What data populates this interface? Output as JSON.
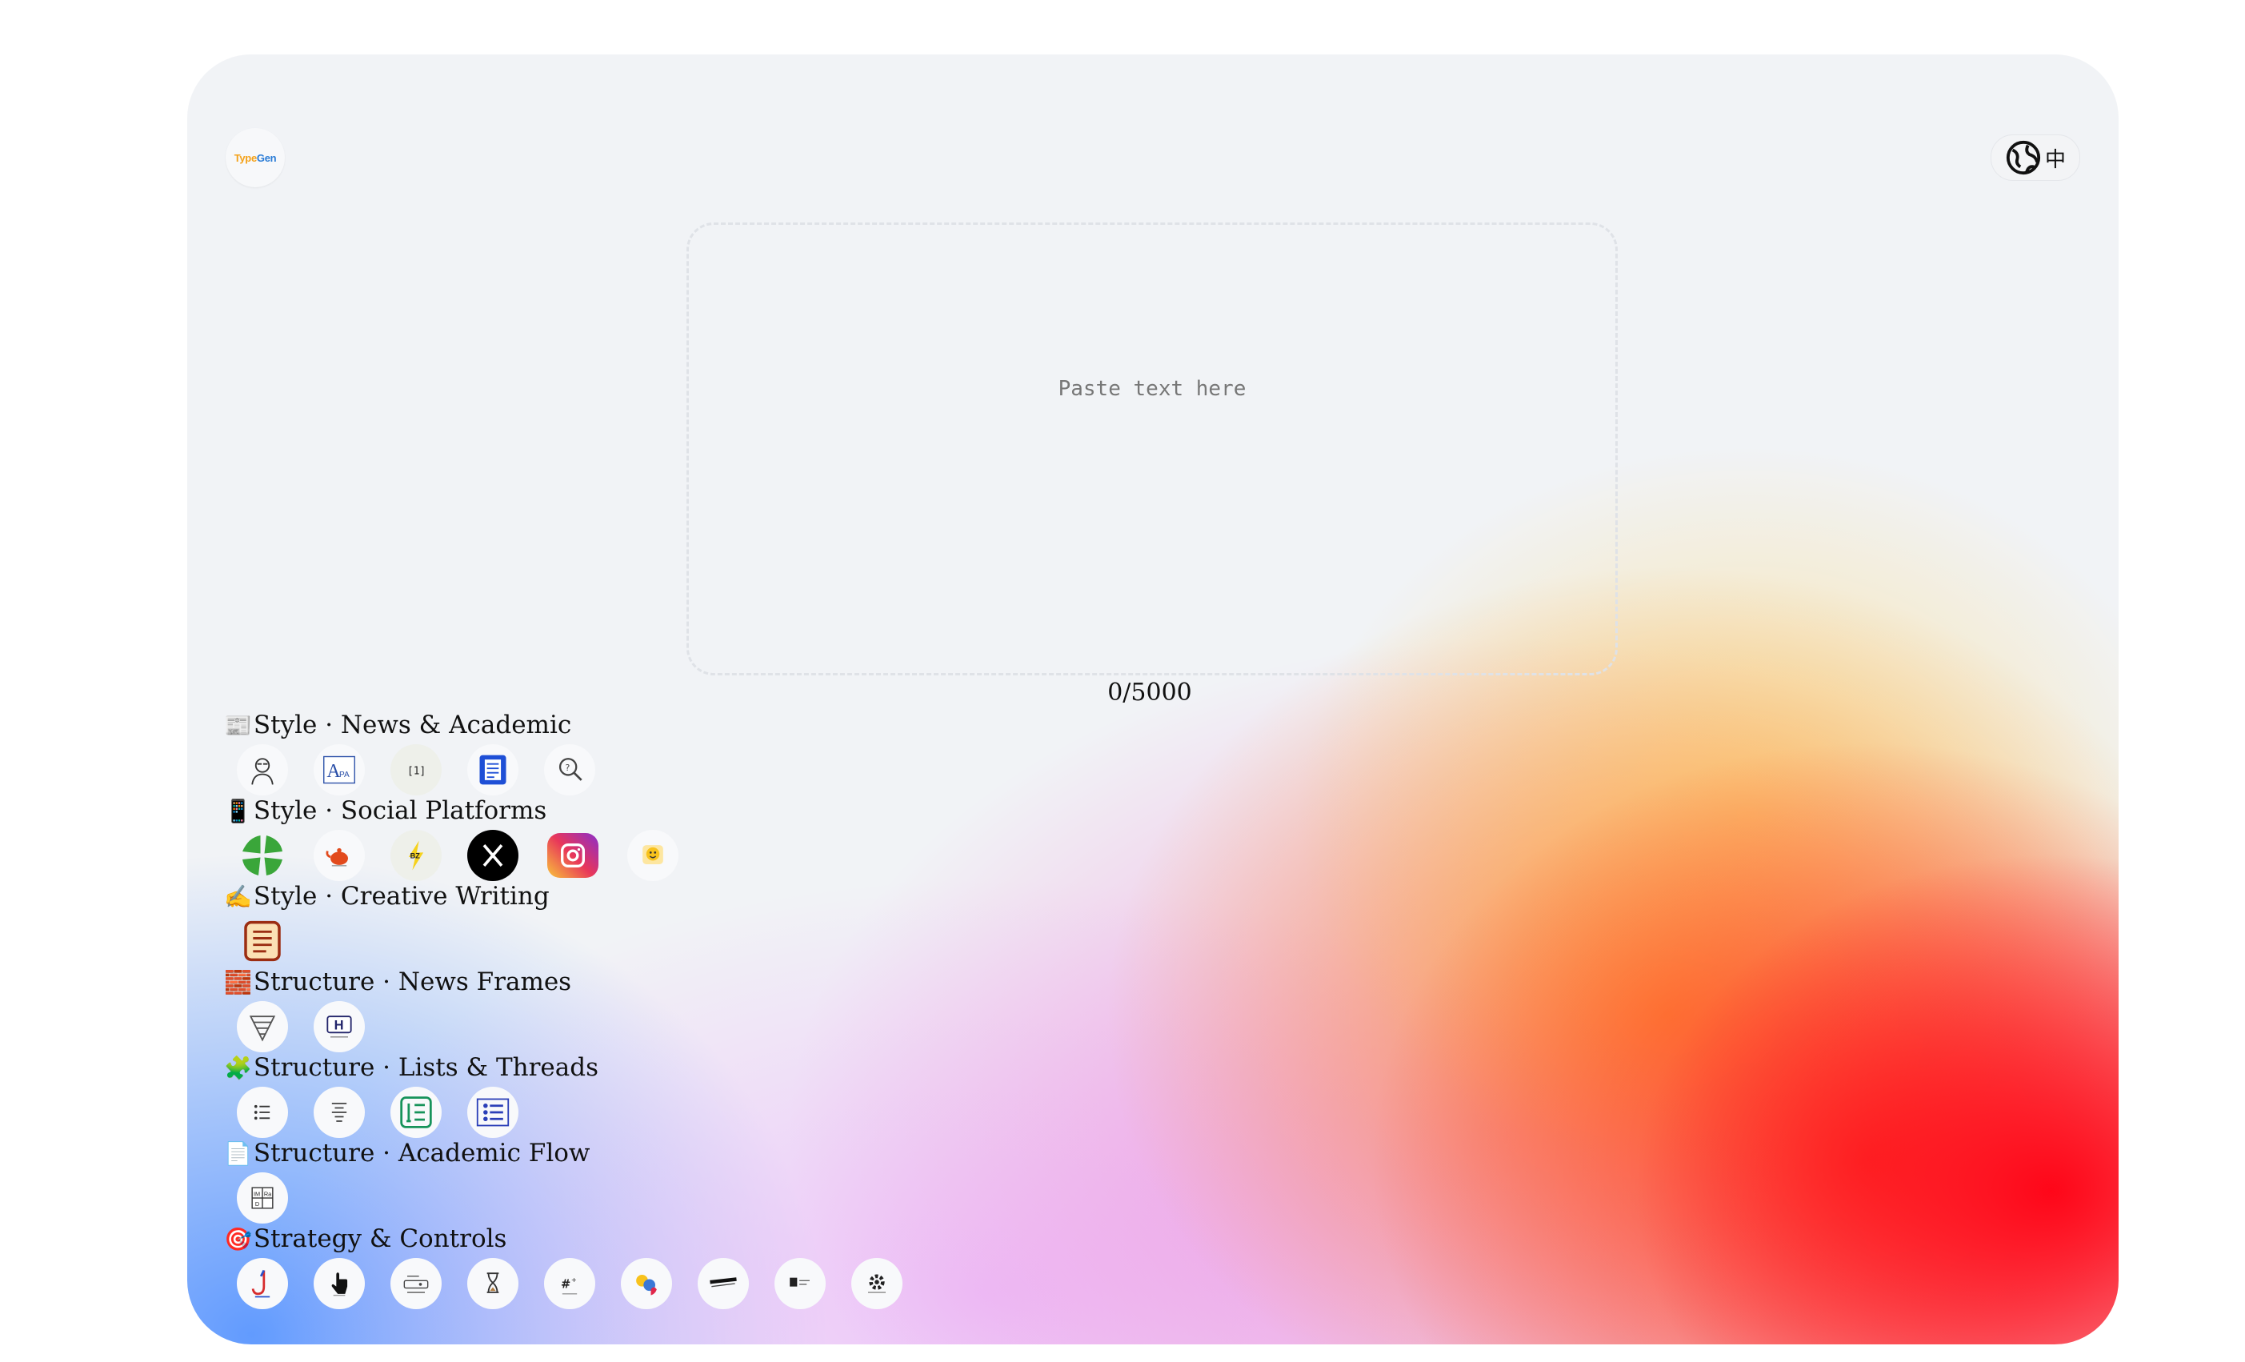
{
  "app": {
    "logo_text_part1": "Type",
    "logo_text_part2": "Gen",
    "language_button_label": "中"
  },
  "editor": {
    "placeholder": "Paste text here",
    "char_count": "0/5000"
  },
  "sections": [
    {
      "emoji": "📰",
      "title": "Style · News & Academic",
      "icons": [
        "portrait-sketch-icon",
        "apa-style-icon",
        "numbered-citation-icon",
        "document-icon",
        "magnifier-icon"
      ]
    },
    {
      "emoji": "📱",
      "title": "Style · Social Platforms",
      "icons": [
        "four-leaf-clover-icon",
        "reddit-teapot-icon",
        "lightning-bz-icon",
        "x-logo-icon",
        "instagram-logo-icon",
        "emoji-face-icon"
      ]
    },
    {
      "emoji": "✍️",
      "title": "Style · Creative Writing",
      "icons": [
        "notepad-icon"
      ]
    },
    {
      "emoji": "🧱",
      "title": "Structure · News Frames",
      "icons": [
        "inverted-pyramid-icon",
        "headline-h-icon"
      ]
    },
    {
      "emoji": "🧩",
      "title": "Structure · Lists & Threads",
      "icons": [
        "bullet-list-icon",
        "thread-list-icon",
        "numbered-list-icon",
        "checklist-icon"
      ]
    },
    {
      "emoji": "📄",
      "title": "Structure · Academic Flow",
      "icons": [
        "imrad-icon"
      ]
    },
    {
      "emoji": "🎯",
      "title": "Strategy & Controls",
      "icons": [
        "clickbait-hook-icon",
        "pointer-hand-icon",
        "cta-keyboard-icon",
        "hourglass-icon",
        "hashtag-icon",
        "emoji-people-icon",
        "keyword-bar-icon",
        "summary-card-icon",
        "settings-gear-icon"
      ]
    }
  ],
  "colors": {
    "card_background": "#f1f3f6",
    "accent_red": "#ff0014",
    "accent_orange": "#ff9628",
    "accent_blue": "#5a96ff",
    "accent_pink": "#f05ac8"
  }
}
